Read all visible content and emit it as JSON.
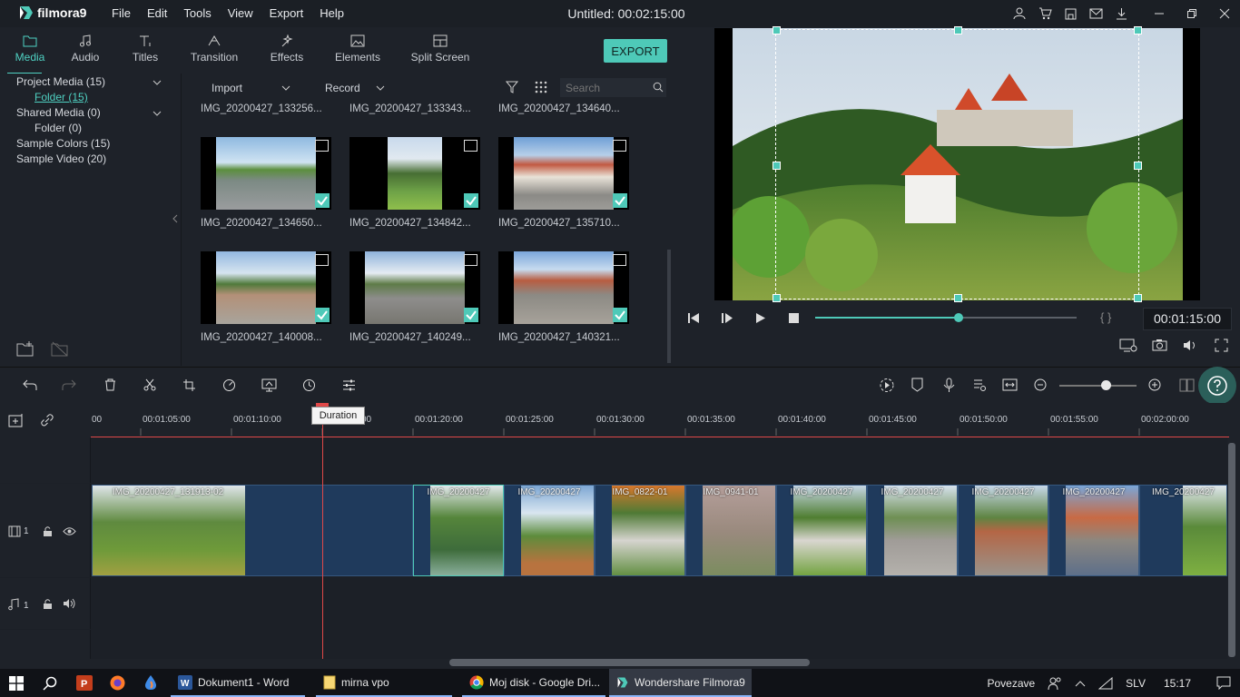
{
  "app": {
    "name": "filmora9",
    "doc_title": "Untitled:  00:02:15:00",
    "menus": [
      "File",
      "Edit",
      "Tools",
      "View",
      "Export",
      "Help"
    ]
  },
  "tabs": [
    {
      "label": "Media",
      "icon": "folder-icon"
    },
    {
      "label": "Audio",
      "icon": "music-note-icon"
    },
    {
      "label": "Titles",
      "icon": "text-icon"
    },
    {
      "label": "Transition",
      "icon": "transition-icon"
    },
    {
      "label": "Effects",
      "icon": "effects-icon"
    },
    {
      "label": "Elements",
      "icon": "image-icon"
    },
    {
      "label": "Split Screen",
      "icon": "split-screen-icon"
    }
  ],
  "export_label": "EXPORT",
  "library": {
    "items": [
      {
        "label": "Project Media (15)"
      },
      {
        "label": "Folder (15)"
      },
      {
        "label": "Shared Media (0)"
      },
      {
        "label": "Folder (0)"
      },
      {
        "label": "Sample Colors (15)"
      },
      {
        "label": "Sample Video (20)"
      }
    ]
  },
  "media_toolbar": {
    "import_label": "Import",
    "record_label": "Record",
    "search_placeholder": "Search"
  },
  "media": [
    {
      "name": "IMG_20200427_133256..."
    },
    {
      "name": "IMG_20200427_133343..."
    },
    {
      "name": "IMG_20200427_134640..."
    },
    {
      "name": "IMG_20200427_134650..."
    },
    {
      "name": "IMG_20200427_134842..."
    },
    {
      "name": "IMG_20200427_135710..."
    },
    {
      "name": "IMG_20200427_140008..."
    },
    {
      "name": "IMG_20200427_140249..."
    },
    {
      "name": "IMG_20200427_140321..."
    }
  ],
  "preview": {
    "timecode": "00:01:15:00",
    "progress": 0.55,
    "brackets": "{    }"
  },
  "timeline": {
    "tooltip": "Duration",
    "ticks": [
      "00",
      "00:01:05:00",
      "00:01:10:00",
      "00",
      "00:01:20:00",
      "00:01:25:00",
      "00:01:30:00",
      "00:01:35:00",
      "00:01:40:00",
      "00:01:45:00",
      "00:01:50:00",
      "00:01:55:00",
      "00:02:00:00"
    ],
    "video_track_label": "1",
    "audio_track_label": "1",
    "clips": [
      {
        "label": "IMG_20200427_131913-02"
      },
      {
        "label": "IMG_20200427"
      },
      {
        "label": "IMG_20200427"
      },
      {
        "label": "IMG_0822-01"
      },
      {
        "label": "IMG_0941-01"
      },
      {
        "label": "IMG_20200427"
      },
      {
        "label": "IMG_20200427"
      },
      {
        "label": "IMG_20200427"
      },
      {
        "label": "IMG_20200427"
      },
      {
        "label": "IMG_20200427"
      }
    ]
  },
  "taskbar": {
    "apps": [
      {
        "label": "Dokument1 - Word"
      },
      {
        "label": "mirna vpo"
      },
      {
        "label": "Moj disk - Google Dri..."
      },
      {
        "label": "Wondershare Filmora9"
      }
    ],
    "network_label": "Povezave",
    "language": "SLV",
    "time": "15:17"
  },
  "colors": {
    "accent": "#4ec9b8",
    "playhead": "#e04848",
    "clip": "#1f3a5c"
  }
}
